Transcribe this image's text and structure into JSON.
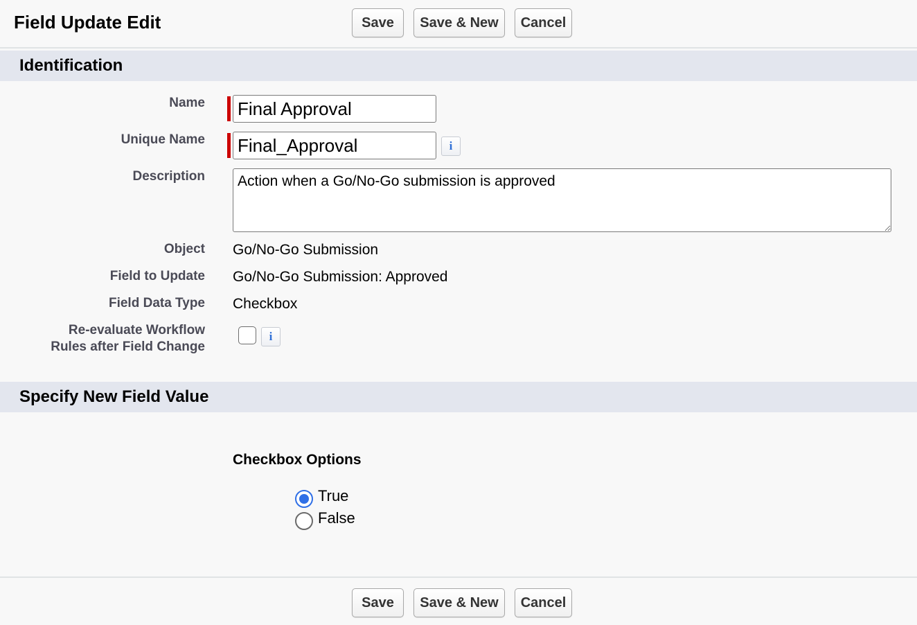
{
  "header": {
    "title": "Field Update Edit",
    "save_label": "Save",
    "save_new_label": "Save & New",
    "cancel_label": "Cancel"
  },
  "identification": {
    "section_title": "Identification",
    "name_label": "Name",
    "name_value": "Final Approval",
    "unique_name_label": "Unique Name",
    "unique_name_value": "Final_Approval",
    "description_label": "Description",
    "description_value": "Action when a Go/No-Go submission is approved",
    "object_label": "Object",
    "object_value": "Go/No-Go Submission",
    "field_to_update_label": "Field to Update",
    "field_to_update_value": "Go/No-Go Submission: Approved",
    "field_data_type_label": "Field Data Type",
    "field_data_type_value": "Checkbox",
    "reevaluate_label_line1": "Re-evaluate Workflow",
    "reevaluate_label_line2": "Rules after Field Change",
    "reevaluate_checked": false,
    "info_glyph": "i"
  },
  "new_value": {
    "section_title": "Specify New Field Value",
    "options_title": "Checkbox Options",
    "options": [
      {
        "label": "True",
        "selected": true
      },
      {
        "label": "False",
        "selected": false
      }
    ]
  },
  "footer": {
    "save_label": "Save",
    "save_new_label": "Save & New",
    "cancel_label": "Cancel"
  },
  "colors": {
    "required_marker": "#c00000",
    "section_header_bg": "#e3e6ee",
    "radio_accent": "#2f6fe6",
    "info_icon": "#2d6ed6"
  }
}
